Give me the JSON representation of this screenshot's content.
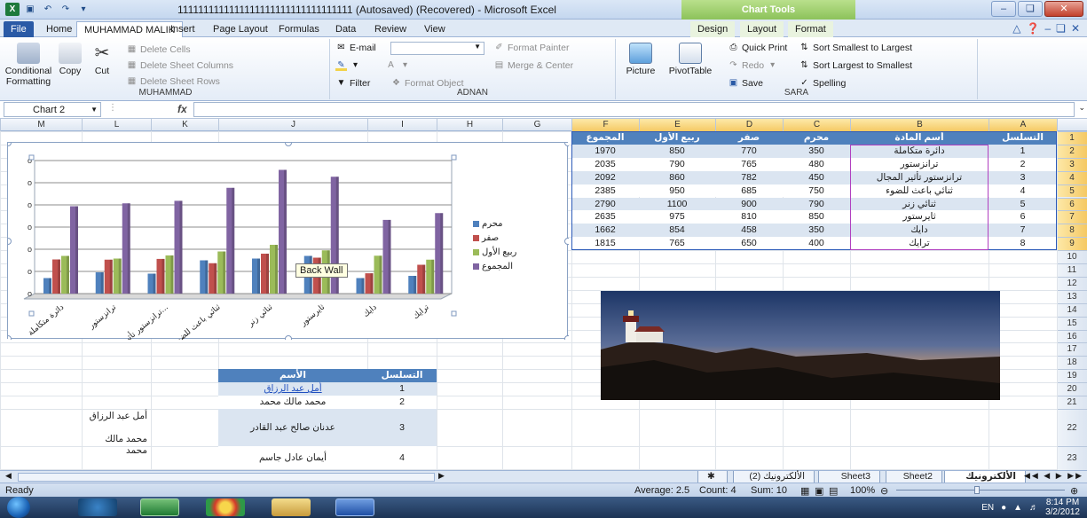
{
  "window": {
    "title": "1111111111111111111111111111111111 (Autosaved) (Recovered) - Microsoft Excel",
    "chart_tools": "Chart Tools"
  },
  "tabs": [
    {
      "label": "File"
    },
    {
      "label": "Home"
    },
    {
      "label": "MUHAMMAD MALIK"
    },
    {
      "label": "Insert"
    },
    {
      "label": "Page Layout"
    },
    {
      "label": "Formulas"
    },
    {
      "label": "Data"
    },
    {
      "label": "Review"
    },
    {
      "label": "View"
    },
    {
      "label": "Design"
    },
    {
      "label": "Layout"
    },
    {
      "label": "Format"
    }
  ],
  "ribbon": {
    "g1": {
      "label": "MUHAMMAD",
      "conditional_formatting": "Conditional Formatting",
      "copy": "Copy",
      "cut": "Cut",
      "delete_cells": "Delete Cells",
      "delete_sheet_columns": "Delete Sheet Columns",
      "delete_sheet_rows": "Delete Sheet Rows"
    },
    "g2": {
      "label": "ADNAN",
      "email": "E-mail",
      "format_painter": "Format Painter",
      "merge_center": "Merge & Center",
      "filter": "Filter",
      "format_object": "Format Object"
    },
    "g3": {
      "label": "SARA",
      "picture": "Picture",
      "pivottable": "PivotTable",
      "quick_print": "Quick Print",
      "redo": "Redo",
      "save": "Save",
      "sort_smallest": "Sort Smallest to Largest",
      "sort_largest": "Sort Largest to Smallest",
      "spelling": "Spelling"
    }
  },
  "formula_bar": {
    "name_box": "Chart 2",
    "fx": "fx",
    "formula": ""
  },
  "columns": [
    "M",
    "L",
    "K",
    "J",
    "I",
    "H",
    "G",
    "F",
    "E",
    "D",
    "C",
    "B",
    "A"
  ],
  "rows": [
    "1",
    "2",
    "3",
    "4",
    "5",
    "6",
    "7",
    "8",
    "9",
    "10",
    "11",
    "12",
    "13",
    "14",
    "15",
    "16",
    "17",
    "18",
    "19",
    "20",
    "21",
    "22",
    "23"
  ],
  "table1": {
    "headers": [
      "التسلسل",
      "أسم المادة",
      "محرم",
      "صفر",
      "ربيع الأول",
      "المجموع"
    ],
    "rows": [
      [
        "1",
        "دائرة متكاملة",
        "350",
        "770",
        "850",
        "1970"
      ],
      [
        "2",
        "ترانزستور",
        "480",
        "765",
        "790",
        "2035"
      ],
      [
        "3",
        "ترانزستور تأثير المجال",
        "450",
        "782",
        "860",
        "2092"
      ],
      [
        "4",
        "ثنائي باعث للضوء",
        "750",
        "685",
        "950",
        "2385"
      ],
      [
        "5",
        "ثنائي زنر",
        "790",
        "900",
        "1100",
        "2790"
      ],
      [
        "6",
        "ثايرستور",
        "850",
        "810",
        "975",
        "2635"
      ],
      [
        "7",
        "دايك",
        "350",
        "458",
        "854",
        "1662"
      ],
      [
        "8",
        "ترايك",
        "400",
        "650",
        "765",
        "1815"
      ]
    ]
  },
  "table2": {
    "headers": [
      "التسلسل",
      "الأسم"
    ],
    "rows": [
      [
        "1",
        "أمل عبد الرزاق"
      ],
      [
        "2",
        "محمد مالك محمد"
      ],
      [
        "3",
        "عدنان صالح عبد القادر"
      ],
      [
        "4",
        "أيمان عادل جاسم"
      ]
    ],
    "extra_l22_a": "أمل عبد الرزاق",
    "extra_l22_b": "محمد مالك محمد"
  },
  "chart": {
    "tooltip": "Back Wall",
    "legend": [
      {
        "name": "محرم",
        "color": "#4f81bd"
      },
      {
        "name": "صفر",
        "color": "#c0504d"
      },
      {
        "name": "ربيع الأول",
        "color": "#9bbb59"
      },
      {
        "name": "المجموع",
        "color": "#8064a2"
      }
    ]
  },
  "chart_data": {
    "type": "bar",
    "categories": [
      "دائرة متكاملة",
      "ترانزستور",
      "ترانزستور تأثير...",
      "ثنائي باعث للضوء",
      "ثنائي زنر",
      "ثايرستور",
      "دايك",
      "ترايك"
    ],
    "series": [
      {
        "name": "محرم",
        "values": [
          350,
          480,
          450,
          750,
          790,
          850,
          350,
          400
        ]
      },
      {
        "name": "صفر",
        "values": [
          770,
          765,
          782,
          685,
          900,
          810,
          458,
          650
        ]
      },
      {
        "name": "ربيع الأول",
        "values": [
          850,
          790,
          860,
          950,
          1100,
          975,
          854,
          765
        ]
      },
      {
        "name": "المجموع",
        "values": [
          1970,
          2035,
          2092,
          2385,
          2790,
          2635,
          1662,
          1815
        ]
      }
    ],
    "ylim": [
      0,
      3000
    ],
    "legend": "right"
  },
  "sheets": [
    {
      "label": "الألكترونيك"
    },
    {
      "label": "Sheet2"
    },
    {
      "label": "Sheet3"
    },
    {
      "label": "الألكترونيك (2)"
    }
  ],
  "status": {
    "ready": "Ready",
    "average": "Average: 2.5",
    "count": "Count: 4",
    "sum": "Sum: 10",
    "zoom": "100%"
  },
  "taskbar": {
    "lang": "EN",
    "time": "8:14 PM",
    "date": "3/2/2012"
  }
}
